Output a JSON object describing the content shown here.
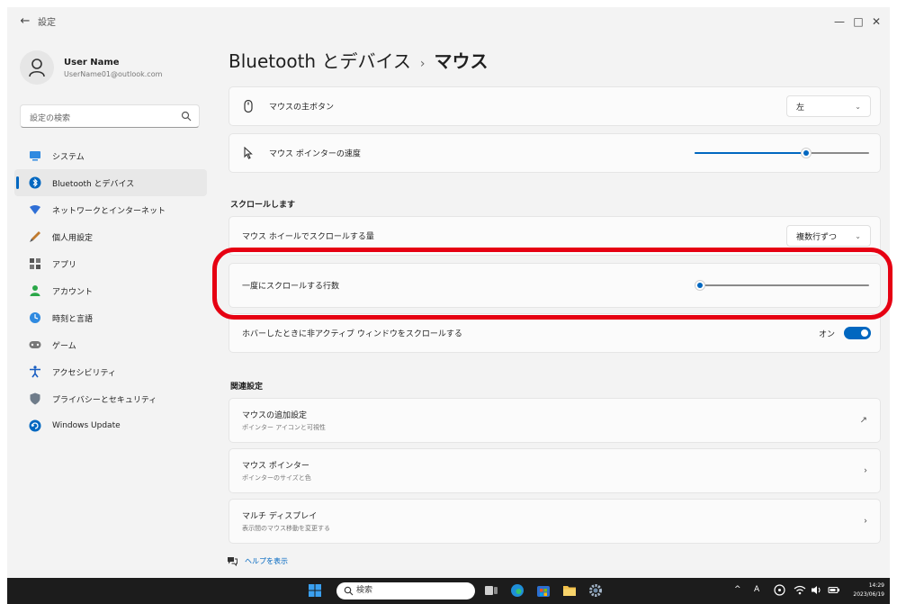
{
  "window": {
    "title": "設定",
    "back_glyph": "←",
    "minimize_glyph": "—",
    "maximize_glyph": "□",
    "close_glyph": "✕"
  },
  "profile": {
    "name": "User Name",
    "email": "UserName01@outlook.com"
  },
  "search": {
    "placeholder": "設定の検索"
  },
  "sidebar": {
    "items": [
      {
        "label": "システム",
        "icon": "system-icon",
        "active": false
      },
      {
        "label": "Bluetooth とデバイス",
        "icon": "bluetooth-icon",
        "active": true
      },
      {
        "label": "ネットワークとインターネット",
        "icon": "network-icon",
        "active": false
      },
      {
        "label": "個人用設定",
        "icon": "personalization-icon",
        "active": false
      },
      {
        "label": "アプリ",
        "icon": "apps-icon",
        "active": false
      },
      {
        "label": "アカウント",
        "icon": "account-icon",
        "active": false
      },
      {
        "label": "時刻と言語",
        "icon": "time-language-icon",
        "active": false
      },
      {
        "label": "ゲーム",
        "icon": "gaming-icon",
        "active": false
      },
      {
        "label": "アクセシビリティ",
        "icon": "accessibility-icon",
        "active": false
      },
      {
        "label": "プライバシーとセキュリティ",
        "icon": "privacy-icon",
        "active": false
      },
      {
        "label": "Windows Update",
        "icon": "windows-update-icon",
        "active": false
      }
    ]
  },
  "breadcrumb": {
    "parent": "Bluetooth とデバイス",
    "separator": "›",
    "current": "マウス"
  },
  "settings": {
    "primary_button": {
      "label": "マウスの主ボタン",
      "value": "左"
    },
    "pointer_speed": {
      "label": "マウス ポインターの速度",
      "level": 0.64
    },
    "scroll_section_title": "スクロールします",
    "wheel_scroll": {
      "label": "マウス ホイールでスクロールする量",
      "value": "複数行ずつ"
    },
    "lines_to_scroll": {
      "label": "一度にスクロールする行数",
      "level": 0.03
    },
    "inactive_scroll": {
      "label": "ホバーしたときに非アクティブ ウィンドウをスクロールする",
      "state": "オン"
    }
  },
  "related": {
    "title": "関連設定",
    "items": [
      {
        "label": "マウスの追加設定",
        "sub": "ポインター アイコンと可視性",
        "trail": "↗"
      },
      {
        "label": "マウス ポインター",
        "sub": "ポインターのサイズと色",
        "trail": "›"
      },
      {
        "label": "マルチ ディスプレイ",
        "sub": "表示間のマウス移動を変更する",
        "trail": "›"
      }
    ]
  },
  "help": {
    "label": "ヘルプを表示"
  },
  "taskbar": {
    "search_label": "検索",
    "tray_caret": "^",
    "ime_indicator": "A",
    "time": "14:29",
    "date": "2023/06/19"
  },
  "colors": {
    "accent": "#0067c0",
    "highlight": "#e60012",
    "taskbar": "#1c1c1c"
  }
}
